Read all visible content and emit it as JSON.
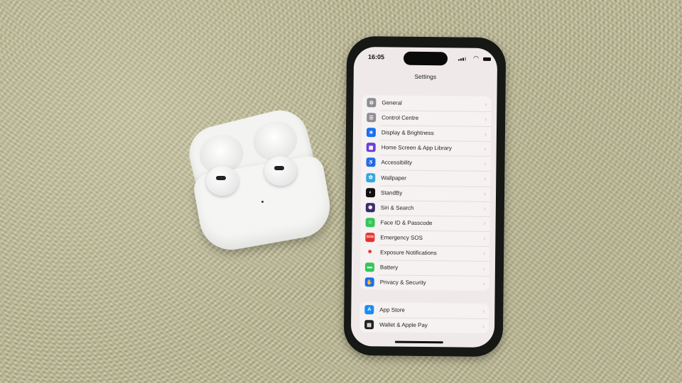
{
  "status_bar": {
    "time": "16:05",
    "signal_icon": "cellular-signal-icon",
    "wifi_icon": "wifi-icon",
    "battery_icon": "battery-icon"
  },
  "header": {
    "title": "Settings"
  },
  "groups": [
    {
      "items": [
        {
          "label": "General",
          "icon": "gear-icon",
          "color": "#8e8e93",
          "glyph": "⚙"
        },
        {
          "label": "Control Centre",
          "icon": "toggles-icon",
          "color": "#8e8e93",
          "glyph": "☰"
        },
        {
          "label": "Display & Brightness",
          "icon": "sun-icon",
          "color": "#1c6ff0",
          "glyph": "☀"
        },
        {
          "label": "Home Screen & App Library",
          "icon": "app-grid-icon",
          "color": "#6a3fd8",
          "glyph": "▦"
        },
        {
          "label": "Accessibility",
          "icon": "accessibility-icon",
          "color": "#1c6ff0",
          "glyph": "♿"
        },
        {
          "label": "Wallpaper",
          "icon": "flower-icon",
          "color": "#35a8e0",
          "glyph": "✿"
        },
        {
          "label": "StandBy",
          "icon": "standby-icon",
          "color": "#111111",
          "glyph": "◐"
        },
        {
          "label": "Siri & Search",
          "icon": "siri-icon",
          "color": "#3a2d6a",
          "glyph": "◉"
        },
        {
          "label": "Face ID & Passcode",
          "icon": "face-id-icon",
          "color": "#34c759",
          "glyph": "☺"
        },
        {
          "label": "Emergency SOS",
          "icon": "sos-icon",
          "color": "#e5322d",
          "glyph": "SOS"
        },
        {
          "label": "Exposure Notifications",
          "icon": "exposure-icon",
          "color": "#f6f2f2",
          "glyph": "✹"
        },
        {
          "label": "Battery",
          "icon": "battery-setting-icon",
          "color": "#34c759",
          "glyph": "▬"
        },
        {
          "label": "Privacy & Security",
          "icon": "hand-icon",
          "color": "#1c6ff0",
          "glyph": "✋"
        }
      ]
    },
    {
      "items": [
        {
          "label": "App Store",
          "icon": "app-store-icon",
          "color": "#1a8cf5",
          "glyph": "A"
        },
        {
          "label": "Wallet & Apple Pay",
          "icon": "wallet-icon",
          "color": "#222222",
          "glyph": "▤"
        }
      ]
    }
  ],
  "chevron": "›"
}
